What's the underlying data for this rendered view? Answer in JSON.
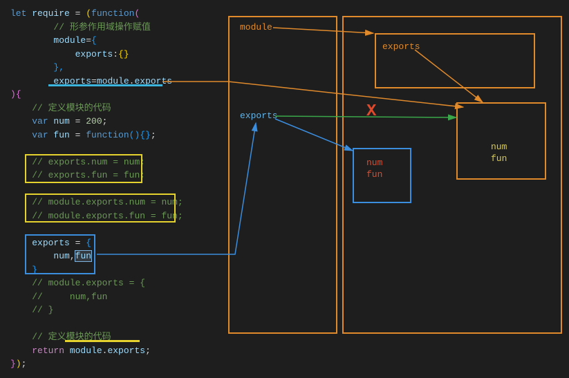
{
  "code": {
    "l1a": "let",
    "l1b": " require ",
    "l1c": "=",
    "l1d": " (",
    "l1e": "function",
    "l1f": "(",
    "l2": "// 形参作用域操作赋值",
    "l3a": "module",
    "l3b": "=",
    "l3c": "{",
    "l4a": "exports",
    "l4b": ":",
    "l4c": "{}",
    "l5": "},",
    "l6a": "exports",
    "l6b": "=",
    "l6c": "module",
    "l6d": ".",
    "l6e": "exports",
    "l7a": ")",
    "l7b": "{",
    "l8": "// 定义模块的代码",
    "l9a": "var",
    "l9b": " num ",
    "l9c": "=",
    "l9d": " 200",
    "l9e": ";",
    "l10a": "var",
    "l10b": " fun ",
    "l10c": "=",
    "l10d": " function",
    "l10e": "()",
    "l10f": "{}",
    "l10g": ";",
    "l11": "// exports.num = num;",
    "l12": "// exports.fun = fun;",
    "l13": "// module.exports.num = num;",
    "l14": "// module.exports.fun = fun;",
    "l15a": "exports",
    "l15b": " = ",
    "l15c": "{",
    "l16a": "num",
    "l16b": ",",
    "l16c": "fun",
    "l17": "}",
    "l18": "// module.exports = {",
    "l19": "//     num,fun",
    "l20": "// }",
    "l21": "// 定义模块的代码",
    "l22a": "return",
    "l22b": " module",
    "l22c": ".",
    "l22d": "exports",
    "l22e": ";",
    "l23a": "}",
    "l23b": ")",
    "l23c": ";"
  },
  "diagram": {
    "module_label": "module",
    "exports_label1": "exports",
    "exports_label2": "exports",
    "num_label": "num",
    "fun_label": "fun",
    "num_fun_red_num": "num",
    "num_fun_red_fun": "fun"
  }
}
